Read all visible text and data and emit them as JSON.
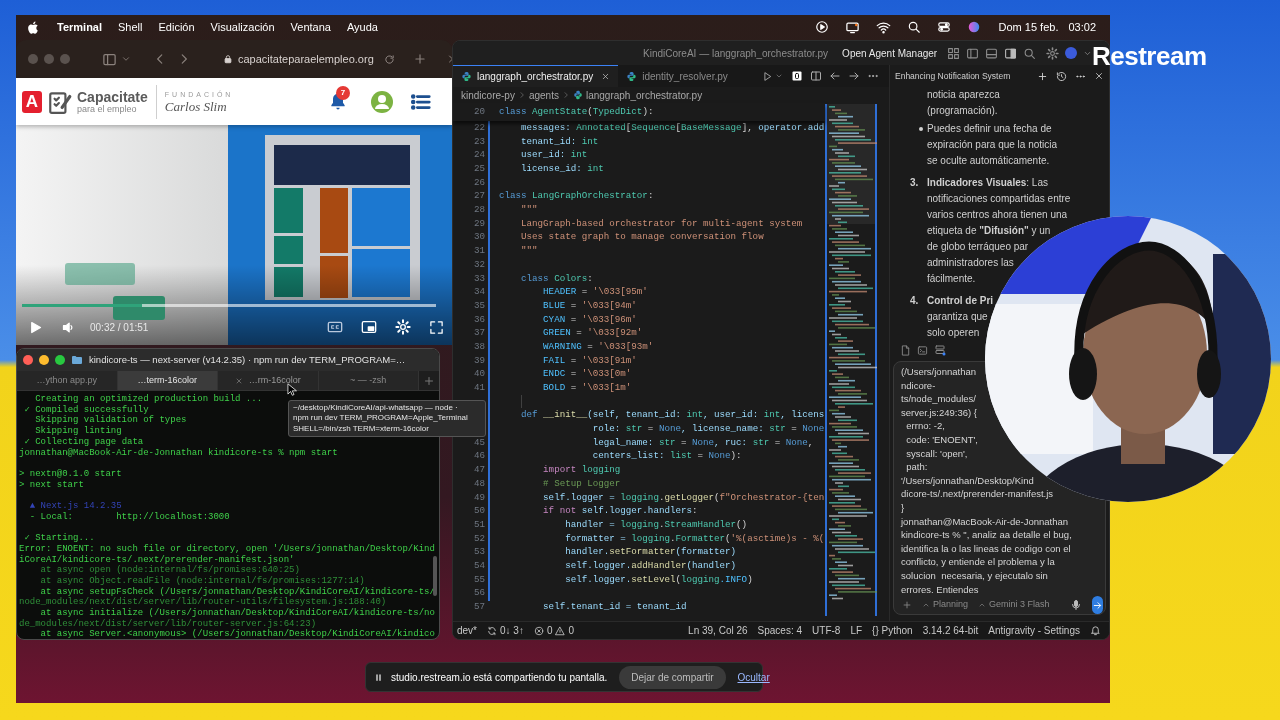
{
  "menu_bar": {
    "app": "Terminal",
    "items": [
      "Shell",
      "Edición",
      "Visualización",
      "Ventana",
      "Ayuda"
    ],
    "date": "Dom 15 feb.",
    "time": "03:02"
  },
  "browser": {
    "url": "capacitateparaelempleo.org",
    "site": {
      "logo_letter": "A",
      "brand": "Capacitate",
      "tagline": "para el empleo",
      "partner_top": "FUNDACIÓN",
      "partner_name": "Carlos Slim",
      "notifications": "7"
    },
    "video": {
      "time": "00:32 / 01:51",
      "level": 0.29
    }
  },
  "terminal": {
    "title": "kindicore-ts — next-server (v14.2.35) · npm run dev TERM_PROGRAM=…",
    "tabs": [
      {
        "label": "…ython app.py",
        "selected": false,
        "hovered": false
      },
      {
        "label": "…term-16color",
        "selected": true,
        "hovered": false
      },
      {
        "label": "…rm-16color",
        "selected": false,
        "hovered": true
      },
      {
        "label": "~ — -zsh",
        "selected": false,
        "hovered": false
      }
    ],
    "lines": [
      {
        "text": "   Creating an optimized production build ...",
        "kind": "bright"
      },
      {
        "text": " ✓ Compiled successfully",
        "kind": "bright"
      },
      {
        "text": "   Skipping validation of types",
        "kind": "bright"
      },
      {
        "text": "   Skipping linting",
        "kind": "bright"
      },
      {
        "text": " ✓ Collecting page data",
        "kind": "bright"
      },
      {
        "text": "jonnathan@MacBook-Air-de-Jonnathan kindicore-ts % npm start",
        "kind": "bright"
      },
      {
        "kind": "blank"
      },
      {
        "text": "> nextn@0.1.0 start",
        "kind": "bright"
      },
      {
        "text": "> next start",
        "kind": "bright"
      },
      {
        "kind": "blank"
      },
      {
        "text": "  ▲ Next.js 14.2.35",
        "kind": "link"
      },
      {
        "text": "  - Local:        http://localhost:3000",
        "kind": "bright"
      },
      {
        "kind": "blank"
      },
      {
        "text": " ✓ Starting...",
        "kind": "bright"
      },
      {
        "text": "Error: ENOENT: no such file or directory, open '/Users/jonnathan/Desktop/Kind",
        "kind": "bright"
      },
      {
        "text": "iCoreAI/kindicore-ts/.next/prerender-manifest.json'",
        "kind": "bright"
      },
      {
        "text": "    at async open (node:internal/fs/promises:640:25)",
        "kind": "dim"
      },
      {
        "text": "    at async Object.readFile (node:internal/fs/promises:1277:14)",
        "kind": "dim"
      },
      {
        "text": "    at async setupFsCheck (/Users/jonnathan/Desktop/KindiCoreAI/kindicore-ts/",
        "kind": "bright"
      },
      {
        "text": "node_modules/next/dist/server/lib/router-utils/filesystem.js:188:40)",
        "kind": "dim"
      },
      {
        "text": "    at async initialize (/Users/jonnathan/Desktop/KindiCoreAI/kindicore-ts/no",
        "kind": "bright"
      },
      {
        "text": "de_modules/next/dist/server/lib/router-server.js:64:23)",
        "kind": "dim"
      },
      {
        "text": "    at async Server.<anonymous> (/Users/jonnathan/Desktop/KindiCoreAI/kindico",
        "kind": "bright"
      }
    ],
    "tooltip": [
      "~/desktop/KindiCoreAI/api-whatsapp — node ·",
      "npm run dev TERM_PROGRAM=Apple_Terminal",
      "SHELL=/bin/zsh TERM=xterm-16color"
    ]
  },
  "editor": {
    "title": "KindiCoreAI — langgraph_orchestrator.py",
    "agent_manager": "Open Agent Manager",
    "tabs": [
      {
        "label": "langgraph_orchestrator.py",
        "selected": true
      },
      {
        "label": "identity_resolver.py",
        "selected": false
      }
    ],
    "breadcrumb": [
      "kindicore-py",
      "agents",
      "langgraph_orchestrator.py"
    ],
    "sticky": {
      "n": "20",
      "tokens": [
        {
          "text": "class ",
          "kind": "kw"
        },
        {
          "text": "AgentState",
          "kind": "cls"
        },
        {
          "text": "(",
          "kind": "plain"
        },
        {
          "text": "TypedDict",
          "kind": "cls"
        },
        {
          "text": "):",
          "kind": "plain"
        }
      ]
    },
    "lines": [
      {
        "n": "22",
        "tokens": [
          {
            "text": "    messages: ",
            "kind": "var"
          },
          {
            "text": "Annotated",
            "kind": "cls"
          },
          {
            "text": "[",
            "kind": "plain"
          },
          {
            "text": "Sequence",
            "kind": "cls"
          },
          {
            "text": "[",
            "kind": "plain"
          },
          {
            "text": "BaseMessage",
            "kind": "cls"
          },
          {
            "text": "], ",
            "kind": "plain"
          },
          {
            "text": "operator.add",
            "kind": "var"
          }
        ]
      },
      {
        "n": "23",
        "tokens": [
          {
            "text": "    tenant_id: ",
            "kind": "var"
          },
          {
            "text": "int",
            "kind": "cls"
          }
        ]
      },
      {
        "n": "24",
        "tokens": [
          {
            "text": "    user_id: ",
            "kind": "var"
          },
          {
            "text": "int",
            "kind": "cls"
          }
        ]
      },
      {
        "n": "25",
        "tokens": [
          {
            "text": "    license_id: ",
            "kind": "var"
          },
          {
            "text": "int",
            "kind": "cls"
          }
        ]
      },
      {
        "n": "26"
      },
      {
        "n": "27",
        "tokens": [
          {
            "text": "class ",
            "kind": "kw"
          },
          {
            "text": "LangGraphOrchestrator",
            "kind": "cls"
          },
          {
            "text": ":",
            "kind": "plain"
          }
        ]
      },
      {
        "n": "28",
        "tokens": [
          {
            "text": "    \"\"\"",
            "kind": "str"
          }
        ]
      },
      {
        "n": "29",
        "tokens": [
          {
            "text": "    LangGraph-based orchestrator for multi-agent system",
            "kind": "str"
          }
        ]
      },
      {
        "n": "30",
        "tokens": [
          {
            "text": "    Uses state graph to manage conversation flow",
            "kind": "str"
          }
        ]
      },
      {
        "n": "31",
        "tokens": [
          {
            "text": "    \"\"\"",
            "kind": "str"
          }
        ]
      },
      {
        "n": "32"
      },
      {
        "n": "33",
        "tokens": [
          {
            "text": "    class ",
            "kind": "kw"
          },
          {
            "text": "Colors",
            "kind": "cls"
          },
          {
            "text": ":",
            "kind": "plain"
          }
        ]
      },
      {
        "n": "34",
        "tokens": [
          {
            "text": "        HEADER",
            "kind": "const"
          },
          {
            "text": " = ",
            "kind": "plain"
          },
          {
            "text": "'\\033[95m'",
            "kind": "str"
          }
        ]
      },
      {
        "n": "35",
        "tokens": [
          {
            "text": "        BLUE",
            "kind": "const"
          },
          {
            "text": " = ",
            "kind": "plain"
          },
          {
            "text": "'\\033[94m'",
            "kind": "str"
          }
        ]
      },
      {
        "n": "36",
        "tokens": [
          {
            "text": "        CYAN",
            "kind": "const"
          },
          {
            "text": " = ",
            "kind": "plain"
          },
          {
            "text": "'\\033[96m'",
            "kind": "str"
          }
        ]
      },
      {
        "n": "37",
        "tokens": [
          {
            "text": "        GREEN",
            "kind": "const"
          },
          {
            "text": " = ",
            "kind": "plain"
          },
          {
            "text": "'\\033[92m'",
            "kind": "str"
          }
        ]
      },
      {
        "n": "38",
        "tokens": [
          {
            "text": "        WARNING",
            "kind": "const"
          },
          {
            "text": " = ",
            "kind": "plain"
          },
          {
            "text": "'\\033[93m'",
            "kind": "str"
          }
        ]
      },
      {
        "n": "39",
        "tokens": [
          {
            "text": "        FAIL",
            "kind": "const"
          },
          {
            "text": " = ",
            "kind": "plain"
          },
          {
            "text": "'\\033[91m'",
            "kind": "str"
          }
        ]
      },
      {
        "n": "40",
        "tokens": [
          {
            "text": "        ENDC",
            "kind": "const"
          },
          {
            "text": " = ",
            "kind": "plain"
          },
          {
            "text": "'\\033[0m'",
            "kind": "str"
          }
        ]
      },
      {
        "n": "41",
        "tokens": [
          {
            "text": "        BOLD",
            "kind": "const"
          },
          {
            "text": " = ",
            "kind": "plain"
          },
          {
            "text": "'\\033[1m'",
            "kind": "str"
          }
        ]
      },
      {
        "kind": "blank"
      },
      {
        "tokens": [
          {
            "text": "    def ",
            "kind": "kw"
          },
          {
            "text": "__init__",
            "kind": "fn"
          },
          {
            "text": "(self, tenant_id: ",
            "kind": "var"
          },
          {
            "text": "int",
            "kind": "cls"
          },
          {
            "text": ", user_id: ",
            "kind": "var"
          },
          {
            "text": "int",
            "kind": "cls"
          },
          {
            "text": ", licens",
            "kind": "var"
          }
        ]
      },
      {
        "tokens": [
          {
            "text": "                 role: ",
            "kind": "var"
          },
          {
            "text": "str",
            "kind": "cls"
          },
          {
            "text": " = ",
            "kind": "plain"
          },
          {
            "text": "None",
            "kind": "kw"
          },
          {
            "text": ", license_name: ",
            "kind": "var"
          },
          {
            "text": "str",
            "kind": "cls"
          },
          {
            "text": " = ",
            "kind": "plain"
          },
          {
            "text": "None",
            "kind": "kw"
          }
        ]
      },
      {
        "n": "45",
        "tokens": [
          {
            "text": "                 legal_name: ",
            "kind": "var"
          },
          {
            "text": "str",
            "kind": "cls"
          },
          {
            "text": " = ",
            "kind": "plain"
          },
          {
            "text": "None",
            "kind": "kw"
          },
          {
            "text": ", ruc: ",
            "kind": "var"
          },
          {
            "text": "str",
            "kind": "cls"
          },
          {
            "text": " = ",
            "kind": "plain"
          },
          {
            "text": "None",
            "kind": "kw"
          },
          {
            "text": ",",
            "kind": "plain"
          }
        ]
      },
      {
        "n": "46",
        "tokens": [
          {
            "text": "                 centers_list: ",
            "kind": "var"
          },
          {
            "text": "list",
            "kind": "cls"
          },
          {
            "text": " = ",
            "kind": "plain"
          },
          {
            "text": "None",
            "kind": "kw"
          },
          {
            "text": "):",
            "kind": "plain"
          }
        ]
      },
      {
        "n": "47",
        "tokens": [
          {
            "text": "        import ",
            "kind": "ctl"
          },
          {
            "text": "logging",
            "kind": "cls"
          }
        ]
      },
      {
        "n": "48",
        "tokens": [
          {
            "text": "        # Setup Logger",
            "kind": "com"
          }
        ]
      },
      {
        "n": "49",
        "tokens": [
          {
            "text": "        self.logger = ",
            "kind": "var"
          },
          {
            "text": "logging",
            "kind": "cls"
          },
          {
            "text": ".",
            "kind": "plain"
          },
          {
            "text": "getLogger",
            "kind": "fn"
          },
          {
            "text": "(",
            "kind": "plain"
          },
          {
            "text": "f\"Orchestrator-{ten",
            "kind": "str"
          }
        ]
      },
      {
        "n": "50",
        "tokens": [
          {
            "text": "        if not ",
            "kind": "ctl"
          },
          {
            "text": "self.logger.handlers",
            "kind": "var"
          },
          {
            "text": ":",
            "kind": "plain"
          }
        ]
      },
      {
        "n": "51",
        "tokens": [
          {
            "text": "            handler = ",
            "kind": "var"
          },
          {
            "text": "logging",
            "kind": "cls"
          },
          {
            "text": ".",
            "kind": "plain"
          },
          {
            "text": "StreamHandler",
            "kind": "cls"
          },
          {
            "text": "()",
            "kind": "plain"
          }
        ]
      },
      {
        "n": "52",
        "tokens": [
          {
            "text": "            formatter = ",
            "kind": "var"
          },
          {
            "text": "logging",
            "kind": "cls"
          },
          {
            "text": ".",
            "kind": "plain"
          },
          {
            "text": "Formatter",
            "kind": "cls"
          },
          {
            "text": "(",
            "kind": "plain"
          },
          {
            "text": "'%(asctime)s - %(",
            "kind": "str"
          }
        ]
      },
      {
        "n": "53",
        "tokens": [
          {
            "text": "            handler.",
            "kind": "var"
          },
          {
            "text": "setFormatter",
            "kind": "fn"
          },
          {
            "text": "(formatter)",
            "kind": "var"
          }
        ]
      },
      {
        "n": "54",
        "tokens": [
          {
            "text": "            self.logger.",
            "kind": "var"
          },
          {
            "text": "addHandler",
            "kind": "fn"
          },
          {
            "text": "(handler)",
            "kind": "var"
          }
        ]
      },
      {
        "n": "55",
        "tokens": [
          {
            "text": "            self.logger.",
            "kind": "var"
          },
          {
            "text": "setLevel",
            "kind": "fn"
          },
          {
            "text": "(",
            "kind": "plain"
          },
          {
            "text": "logging",
            "kind": "cls"
          },
          {
            "text": ".INFO",
            "kind": "const"
          },
          {
            "text": ")",
            "kind": "plain"
          }
        ]
      },
      {
        "n": "56"
      },
      {
        "n": "57",
        "tokens": [
          {
            "text": "        self.tenant_id = tenant_id",
            "kind": "var"
          }
        ]
      }
    ],
    "status_left": {
      "branch": "dev*",
      "sync": "0↓ 3↑",
      "errors": "0",
      "warnings": "0"
    },
    "status_right": [
      "Ln 39, Col 26",
      "Spaces: 4",
      "UTF-8",
      "LF",
      "{} Python",
      "3.14.2 64-bit",
      "Antigravity - Settings"
    ]
  },
  "agent_panel": {
    "title": "Enhancing Notification System",
    "blocks": [
      {
        "kind": "text",
        "lines": [
          "noticia aparezca",
          "(programación)."
        ]
      },
      {
        "kind": "bullet",
        "lines": [
          "Puedes definir una fecha de",
          "expiración para que la noticia",
          "se oculte automáticamente."
        ]
      },
      {
        "kind": "numbered",
        "number": "3.",
        "lines": [
          "**Indicadores Visuales**: Las",
          "notificaciones compartidas entre",
          "varios centros ahora tienen una",
          "etiqueta de **\"Difusión\"** y un",
          "de globo terráqueo par",
          "administradores las",
          "fácilmente."
        ]
      },
      {
        "kind": "numbered",
        "number": "4.",
        "lines": [
          "**Control de Pri**",
          "garantiza que",
          "solo operen"
        ]
      }
    ],
    "input_lines": [
      "(/Users/jonnathan",
      "ndicore-",
      "ts/node_modules/",
      "server.js:249:36) {",
      "  errno: -2,",
      "  code: 'ENOENT',",
      "  syscall: 'open',",
      "  path:",
      "'/Users/jonnathan/Desktop/Kind",
      "dicore-ts/.next/prerender-manifest.js",
      "}",
      "jonnathan@MacBook-Air-de-Jonnathan",
      "kindicore-ts % \", analiz aa detalle el bug,",
      "identifica la o las lineas de codigo con el",
      "conflicto, y entiende el problema y la",
      "solucion  necesaria, y ejecutalo sin",
      "errores. Entiendes"
    ],
    "mode": "Planning",
    "model": "Gemini 3 Flash"
  },
  "overlay": {
    "brand": "Restream"
  },
  "share_bar": {
    "message": "studio.restream.io está compartiendo tu pantalla.",
    "stop": "Dejar de compartir",
    "hide": "Ocultar"
  }
}
